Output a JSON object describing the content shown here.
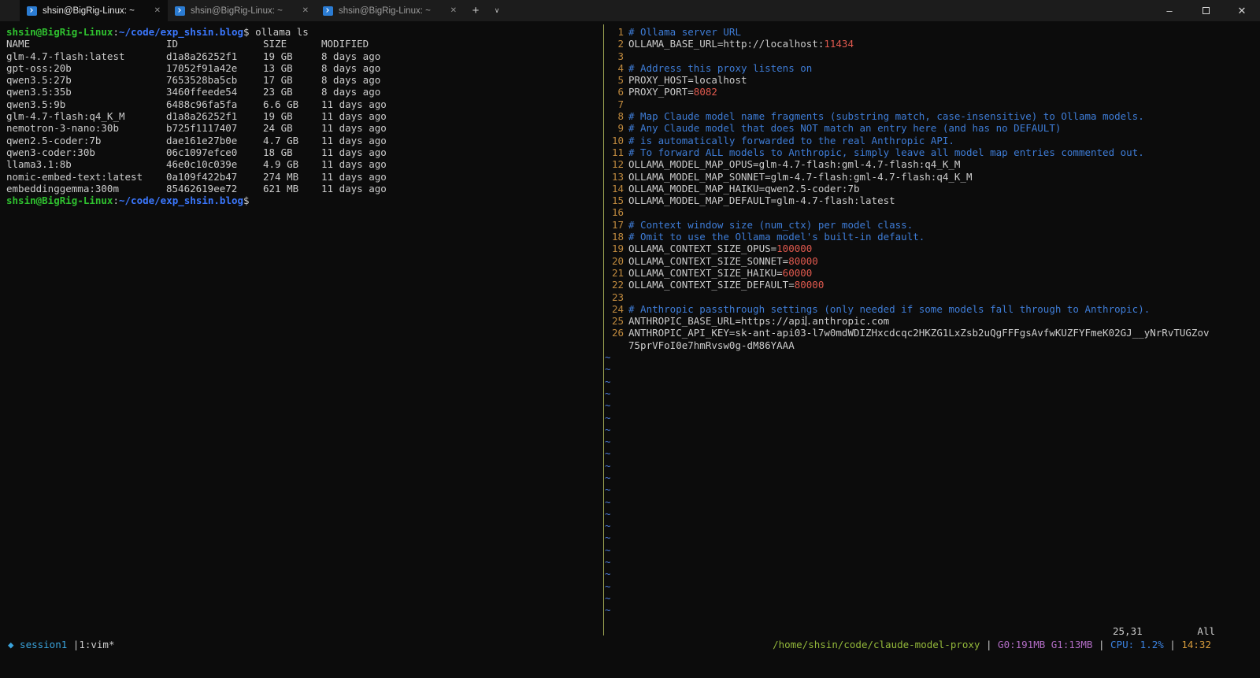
{
  "colors": {
    "bg": "#0c0c0c",
    "fg": "#cccccc",
    "titlebar_bg": "#1c1c1c",
    "tab_active_bg": "#0c0c0c",
    "prompt_green": "#2fc12f",
    "path_blue": "#3b78ff",
    "comment": "#3e7cd6",
    "number": "#e0594e",
    "line_number": "#c08a3e",
    "tilde": "#4d7dd6",
    "divider": "#99a050",
    "tmux_accent": "#3aa3dc",
    "tmux_path": "#93b83a",
    "tmux_mem": "#b16cc4",
    "tmux_cpu": "#3b82e0",
    "tmux_time": "#d79c3c"
  },
  "window": {
    "active_tab": 0,
    "tab_close_glyph": "✕",
    "new_tab_glyph": "+",
    "dropdown_glyph": "∨",
    "tabs": [
      {
        "title": "shsin@BigRig-Linux: ~"
      },
      {
        "title": "shsin@BigRig-Linux: ~"
      },
      {
        "title": "shsin@BigRig-Linux: ~"
      }
    ],
    "controls": {
      "minimize": "–",
      "close": "✕"
    }
  },
  "shell": {
    "prompt": {
      "user_host": "shsin@BigRig-Linux",
      "separator": ":",
      "path": "~/code/exp_shsin.blog",
      "symbol": "$"
    },
    "command": "ollama ls",
    "table": {
      "headers": [
        "NAME",
        "ID",
        "SIZE",
        "MODIFIED"
      ],
      "rows": [
        [
          "glm-4.7-flash:latest",
          "d1a8a26252f1",
          "19 GB",
          "8 days ago"
        ],
        [
          "gpt-oss:20b",
          "17052f91a42e",
          "13 GB",
          "8 days ago"
        ],
        [
          "qwen3.5:27b",
          "7653528ba5cb",
          "17 GB",
          "8 days ago"
        ],
        [
          "qwen3.5:35b",
          "3460ffeede54",
          "23 GB",
          "8 days ago"
        ],
        [
          "qwen3.5:9b",
          "6488c96fa5fa",
          "6.6 GB",
          "11 days ago"
        ],
        [
          "glm-4.7-flash:q4_K_M",
          "d1a8a26252f1",
          "19 GB",
          "11 days ago"
        ],
        [
          "nemotron-3-nano:30b",
          "b725f1117407",
          "24 GB",
          "11 days ago"
        ],
        [
          "qwen2.5-coder:7b",
          "dae161e27b0e",
          "4.7 GB",
          "11 days ago"
        ],
        [
          "qwen3-coder:30b",
          "06c1097efce0",
          "18 GB",
          "11 days ago"
        ],
        [
          "llama3.1:8b",
          "46e0c10c039e",
          "4.9 GB",
          "11 days ago"
        ],
        [
          "nomic-embed-text:latest",
          "0a109f422b47",
          "274 MB",
          "11 days ago"
        ],
        [
          "embeddinggemma:300m",
          "85462619ee72",
          "621 MB",
          "11 days ago"
        ]
      ]
    }
  },
  "editor": {
    "lines": [
      {
        "n": 1,
        "s": [
          [
            "# Ollama server URL",
            "c"
          ]
        ]
      },
      {
        "n": 2,
        "s": [
          [
            "OLLAMA_BASE_URL=http://localhost:",
            "t"
          ],
          [
            "11434",
            "n"
          ]
        ]
      },
      {
        "n": 3,
        "s": []
      },
      {
        "n": 4,
        "s": [
          [
            "# Address this proxy listens on",
            "c"
          ]
        ]
      },
      {
        "n": 5,
        "s": [
          [
            "PROXY_HOST=localhost",
            "t"
          ]
        ]
      },
      {
        "n": 6,
        "s": [
          [
            "PROXY_PORT=",
            "t"
          ],
          [
            "8082",
            "n"
          ]
        ]
      },
      {
        "n": 7,
        "s": []
      },
      {
        "n": 8,
        "s": [
          [
            "# Map Claude model name fragments (substring match, case-insensitive) to Ollama models.",
            "c"
          ]
        ]
      },
      {
        "n": 9,
        "s": [
          [
            "# Any Claude model that does NOT match an entry here (and has no DEFAULT)",
            "c"
          ]
        ]
      },
      {
        "n": 10,
        "s": [
          [
            "# is automatically forwarded to the real Anthropic API.",
            "c"
          ]
        ]
      },
      {
        "n": 11,
        "s": [
          [
            "# To forward ALL models to Anthropic, simply leave all model map entries commented out.",
            "c"
          ]
        ]
      },
      {
        "n": 12,
        "s": [
          [
            "OLLAMA_MODEL_MAP_OPUS=glm-4.7-flash:gml-4.7-flash:q4_K_M",
            "t"
          ]
        ]
      },
      {
        "n": 13,
        "s": [
          [
            "OLLAMA_MODEL_MAP_SONNET=glm-4.7-flash:gml-4.7-flash:q4_K_M",
            "t"
          ]
        ]
      },
      {
        "n": 14,
        "s": [
          [
            "OLLAMA_MODEL_MAP_HAIKU=qwen2.5-coder:7b",
            "t"
          ]
        ]
      },
      {
        "n": 15,
        "s": [
          [
            "OLLAMA_MODEL_MAP_DEFAULT=glm-4.7-flash:latest",
            "t"
          ]
        ]
      },
      {
        "n": 16,
        "s": []
      },
      {
        "n": 17,
        "s": [
          [
            "# Context window size (num_ctx) per model class.",
            "c"
          ]
        ]
      },
      {
        "n": 18,
        "s": [
          [
            "# Omit to use the Ollama model's built-in default.",
            "c"
          ]
        ]
      },
      {
        "n": 19,
        "s": [
          [
            "OLLAMA_CONTEXT_SIZE_OPUS=",
            "t"
          ],
          [
            "100000",
            "n"
          ]
        ]
      },
      {
        "n": 20,
        "s": [
          [
            "OLLAMA_CONTEXT_SIZE_SONNET=",
            "t"
          ],
          [
            "80000",
            "n"
          ]
        ]
      },
      {
        "n": 21,
        "s": [
          [
            "OLLAMA_CONTEXT_SIZE_HAIKU=",
            "t"
          ],
          [
            "60000",
            "n"
          ]
        ]
      },
      {
        "n": 22,
        "s": [
          [
            "OLLAMA_CONTEXT_SIZE_DEFAULT=",
            "t"
          ],
          [
            "80000",
            "n"
          ]
        ]
      },
      {
        "n": 23,
        "s": []
      },
      {
        "n": 24,
        "s": [
          [
            "# Anthropic passthrough settings (only needed if some models fall through to Anthropic).",
            "c"
          ]
        ]
      },
      {
        "n": 25,
        "s": [
          [
            "ANTHROPIC_BASE_URL=https://api",
            "t"
          ],
          [
            ".",
            "t cursor"
          ],
          [
            "anthropic.com",
            "t"
          ]
        ]
      },
      {
        "n": 26,
        "s": [
          [
            "ANTHROPIC_API_KEY=sk-ant-api03-l7w0mdWDIZHxcdcqc2HKZG1LxZsb2uQgFFFgsAvfwKUZFYFmeK02GJ__yNrRvTUGZov",
            "t"
          ]
        ]
      },
      {
        "n": null,
        "s": [
          [
            "75prVFoI0e7hmRvsw0g-dM86YAAA",
            "t"
          ]
        ]
      }
    ],
    "tilde_glyph": "~",
    "tilde_rows": 22,
    "ruler": {
      "cursor_pos": "25,31",
      "scroll_pos": "All"
    }
  },
  "tmux": {
    "left": [
      [
        "◆ session1 ",
        "accent"
      ],
      [
        "|",
        "t"
      ],
      [
        "1:vim*",
        "t"
      ]
    ],
    "right": [
      [
        "/home/shsin/code/claude-model-proxy",
        "green"
      ],
      [
        " | ",
        "t"
      ],
      [
        "G0:191MB G1:13MB",
        "magenta"
      ],
      [
        " | ",
        "t"
      ],
      [
        "CPU: 1.2%",
        "blue"
      ],
      [
        " | ",
        "t"
      ],
      [
        "14:32",
        "yellow"
      ]
    ]
  }
}
